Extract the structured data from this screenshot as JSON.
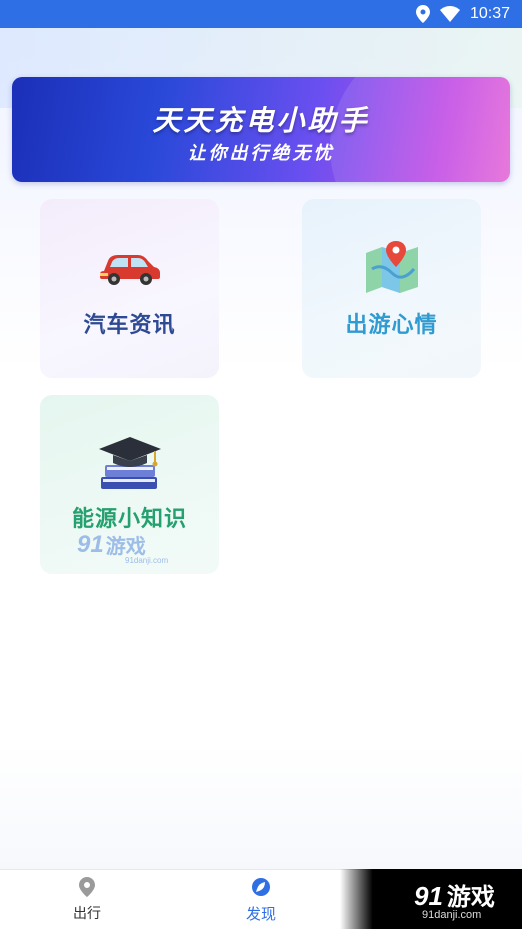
{
  "status_bar": {
    "time": "10:37",
    "icons": [
      "location-icon",
      "wifi-icon"
    ]
  },
  "banner": {
    "title": "天天充电小助手",
    "subtitle": "让你出行绝无忧"
  },
  "cards": [
    {
      "label": "汽车资讯",
      "icon": "red-car-icon"
    },
    {
      "label": "出游心情",
      "icon": "map-pin-icon"
    },
    {
      "label": "能源小知识",
      "icon": "graduation-books-icon"
    }
  ],
  "watermark": {
    "brand_number": "91",
    "brand_text": "游戏",
    "url": "91danji.com"
  },
  "tabbar": {
    "tabs": [
      {
        "label": "出行",
        "icon": "location-pin-icon",
        "active": false
      },
      {
        "label": "发现",
        "icon": "leaf-compass-icon",
        "active": true
      }
    ]
  },
  "corner_logo": {
    "brand_number": "91",
    "brand_text": "游戏",
    "url": "91danji.com"
  },
  "colors": {
    "status_bar": "#2f6fe6",
    "accent": "#2f6fe6",
    "news_label": "#2d4a93",
    "travel_label": "#2f9bd0",
    "knowledge_label": "#25a06f"
  }
}
